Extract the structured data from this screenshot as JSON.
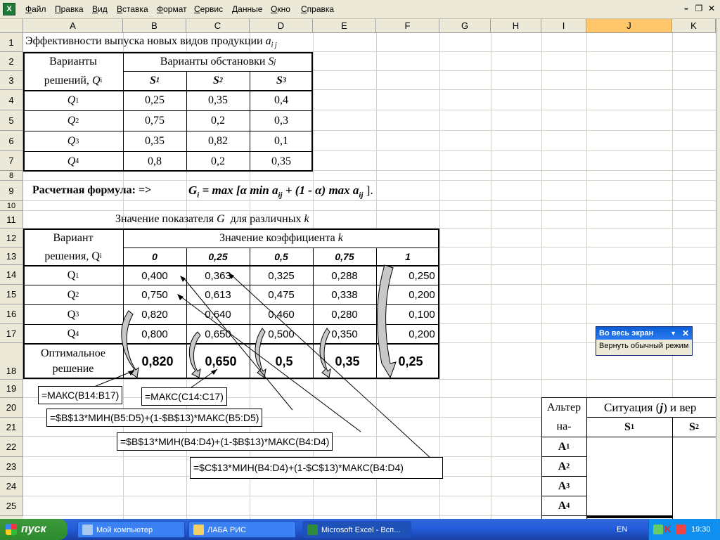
{
  "menu": {
    "items": [
      "Файл",
      "Правка",
      "Вид",
      "Вставка",
      "Формат",
      "Сервис",
      "Данные",
      "Окно",
      "Справка"
    ]
  },
  "window_controls": [
    "–",
    "❐",
    "✕"
  ],
  "columns": [
    "A",
    "B",
    "C",
    "D",
    "E",
    "F",
    "G",
    "H",
    "I",
    "J",
    "K"
  ],
  "rows": [
    "1",
    "2",
    "3",
    "4",
    "5",
    "6",
    "7",
    "8",
    "9",
    "10",
    "11",
    "12",
    "13",
    "14",
    "15",
    "16",
    "17",
    "18",
    "19",
    "20",
    "21",
    "22",
    "23",
    "24",
    "25"
  ],
  "sheet": {
    "title1": "Эффективности выпуска новых видов продукции",
    "title1_var": "a",
    "title1_sub": "i j",
    "t1_header_variants": "Варианты",
    "t1_header_decisions": "решений,",
    "t1_header_q": "Q",
    "t1_header_qsub": "i",
    "t1_header_situations": "Варианты обстановки",
    "t1_header_s": "S",
    "t1_header_ssub": "j",
    "t1_cols": [
      {
        "s": "S",
        "sub": "1"
      },
      {
        "s": "S",
        "sub": "2"
      },
      {
        "s": "S",
        "sub": "3"
      }
    ],
    "t1_rows": [
      {
        "q": "Q",
        "sub": "1",
        "vals": [
          "0,25",
          "0,35",
          "0,4"
        ]
      },
      {
        "q": "Q",
        "sub": "2",
        "vals": [
          "0,75",
          "0,2",
          "0,3"
        ]
      },
      {
        "q": "Q",
        "sub": "3",
        "vals": [
          "0,35",
          "0,82",
          "0,1"
        ]
      },
      {
        "q": "Q",
        "sub": "4",
        "vals": [
          "0,8",
          "0,2",
          "0,35"
        ]
      }
    ],
    "formula_label": "Расчетная формула: =>",
    "formula_G": "G",
    "formula_Gsub": "i",
    "formula_rest1": " = max  [",
    "formula_alpha": "α",
    "formula_min": "  min  a",
    "formula_ij": "ij",
    "formula_plus": " + (1 -  ",
    "formula_alpha2": "α",
    "formula_max": ") max  a",
    "formula_ij2": "ij",
    "formula_end": " ].",
    "t2_title": "Значение показателя",
    "t2_title_G": "G",
    "t2_title_rest": "для различных",
    "t2_title_k": "k",
    "t2_variant": "Вариант",
    "t2_decision": "решения, Q",
    "t2_decision_sub": "i",
    "t2_coef_title": "Значение коэффициента",
    "t2_coef_k": "k",
    "t2_k_values": [
      "0",
      "0,25",
      "0,5",
      "0,75",
      "1"
    ],
    "t2_rows": [
      {
        "q": "Q",
        "sub": "1",
        "vals": [
          "0,400",
          "0,363",
          "0,325",
          "0,288",
          "0,250"
        ]
      },
      {
        "q": "Q",
        "sub": "2",
        "vals": [
          "0,750",
          "0,613",
          "0,475",
          "0,338",
          "0,200"
        ]
      },
      {
        "q": "Q",
        "sub": "3",
        "vals": [
          "0,820",
          "0,640",
          "0,460",
          "0,280",
          "0,100"
        ]
      },
      {
        "q": "Q",
        "sub": "4",
        "vals": [
          "0,800",
          "0,650",
          "0,500",
          "0,350",
          "0,200"
        ]
      }
    ],
    "t2_optimal_1": "Оптимальное",
    "t2_optimal_2": "решение",
    "t2_optimal_vals": [
      "0,820",
      "0,650",
      "0,5",
      "0,35",
      "0,25"
    ],
    "formulas": [
      "=МАКС(B14:B17)",
      "=МАКС(C14:C17)",
      "=$B$13*МИН(B5:D5)+(1-$B$13)*МАКС(B5:D5)",
      "=$B$13*МИН(B4:D4)+(1-$B$13)*МАКС(B4:D4)",
      "=$C$13*МИН(B4:D4)+(1-$C$13)*МАКС(B4:D4)"
    ],
    "t3_alt": "Альтер",
    "t3_alt2": "на-",
    "t3_situation": "Ситуация (",
    "t3_j": "j",
    "t3_situation2": ") и вер",
    "t3_s1": "S",
    "t3_s1sub": "1",
    "t3_s2": "S",
    "t3_s2sub": "2",
    "t3_rows": [
      {
        "a": "A",
        "sub": "1"
      },
      {
        "a": "A",
        "sub": "2"
      },
      {
        "a": "A",
        "sub": "3"
      },
      {
        "a": "A",
        "sub": "4"
      }
    ]
  },
  "fullscreen_toolbar": {
    "title": "Во весь экран",
    "button": "Вернуть обычный режим"
  },
  "taskbar": {
    "start": "пуск",
    "tasks": [
      "Мой компьютер",
      "ЛАБА РИС",
      "Microsoft Excel - Всп..."
    ],
    "lang": "EN",
    "clock": "19:30"
  }
}
